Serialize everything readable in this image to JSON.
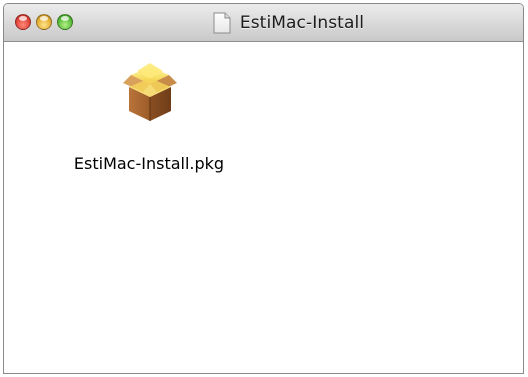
{
  "window": {
    "title": "EstiMac-Install",
    "title_icon": "document-icon"
  },
  "traffic_lights": {
    "close_color": "#e3473d",
    "minimize_color": "#e5b33a",
    "zoom_color": "#5dbf3c"
  },
  "files": [
    {
      "name": "EstiMac-Install.pkg",
      "icon": "package-icon"
    }
  ]
}
